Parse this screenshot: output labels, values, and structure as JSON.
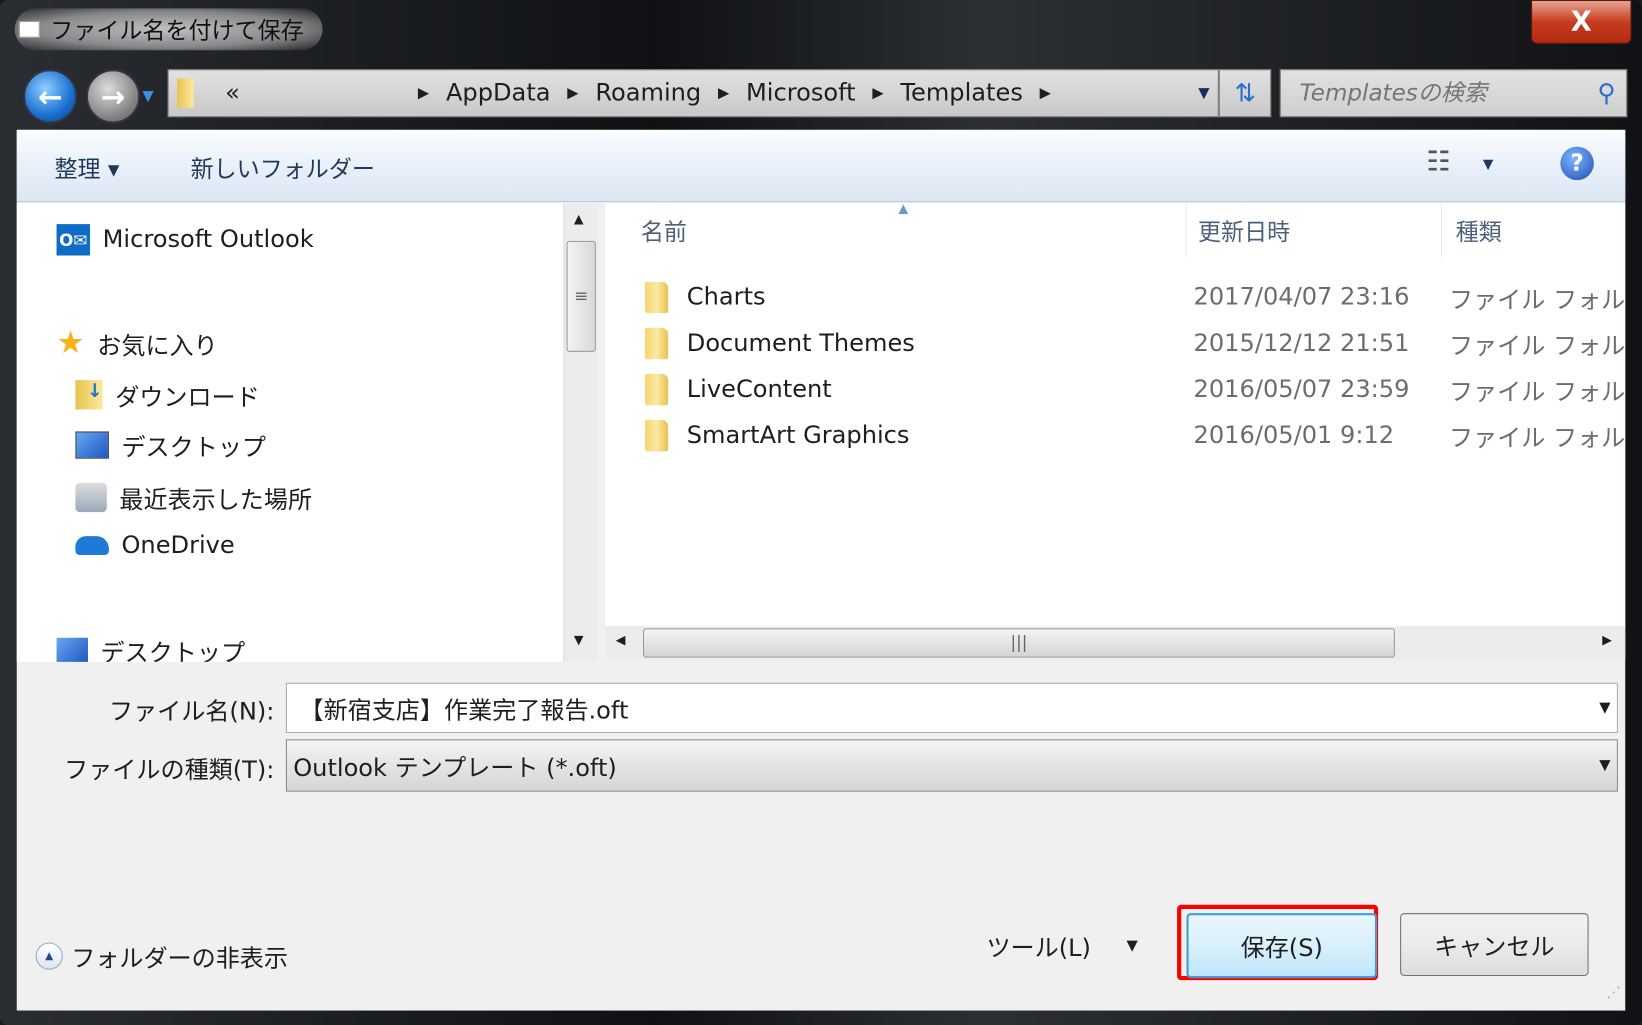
{
  "window": {
    "title": "ファイル名を付けて保存",
    "close_label": "X"
  },
  "address": {
    "crumbs": [
      "«",
      "AppData",
      "Roaming",
      "Microsoft",
      "Templates"
    ]
  },
  "search": {
    "placeholder": "Templatesの検索"
  },
  "toolbar": {
    "organize": "整理 ▾",
    "new_folder": "新しいフォルダー"
  },
  "nav": {
    "items": [
      {
        "label": "Microsoft Outlook",
        "icon": "outlook-icon"
      },
      {
        "label": "お気に入り",
        "icon": "star-icon"
      },
      {
        "label": "ダウンロード",
        "icon": "downloads-folder-icon"
      },
      {
        "label": "デスクトップ",
        "icon": "desktop-icon"
      },
      {
        "label": "最近表示した場所",
        "icon": "recent-places-icon"
      },
      {
        "label": "OneDrive",
        "icon": "onedrive-icon"
      },
      {
        "label": "デスクトップ",
        "icon": "desktop-icon"
      }
    ]
  },
  "list": {
    "columns": [
      "名前",
      "更新日時",
      "種類"
    ],
    "rows": [
      {
        "name": "Charts",
        "date": "2017/04/07 23:16",
        "type": "ファイル フォル"
      },
      {
        "name": "Document Themes",
        "date": "2015/12/12 21:51",
        "type": "ファイル フォル"
      },
      {
        "name": "LiveContent",
        "date": "2016/05/07 23:59",
        "type": "ファイル フォル"
      },
      {
        "name": "SmartArt Graphics",
        "date": "2016/05/01 9:12",
        "type": "ファイル フォル"
      }
    ]
  },
  "form": {
    "filename_label": "ファイル名(N):",
    "filename_value": "【新宿支店】作業完了報告.oft",
    "filetype_label": "ファイルの種類(T):",
    "filetype_value": "Outlook テンプレート (*.oft)"
  },
  "footer": {
    "hide_folders": "フォルダーの非表示",
    "tools": "ツール(L)",
    "save": "保存(S)",
    "cancel": "キャンセル"
  },
  "colors": {
    "highlight": "#ff0000",
    "accent": "#2a6fc9"
  }
}
